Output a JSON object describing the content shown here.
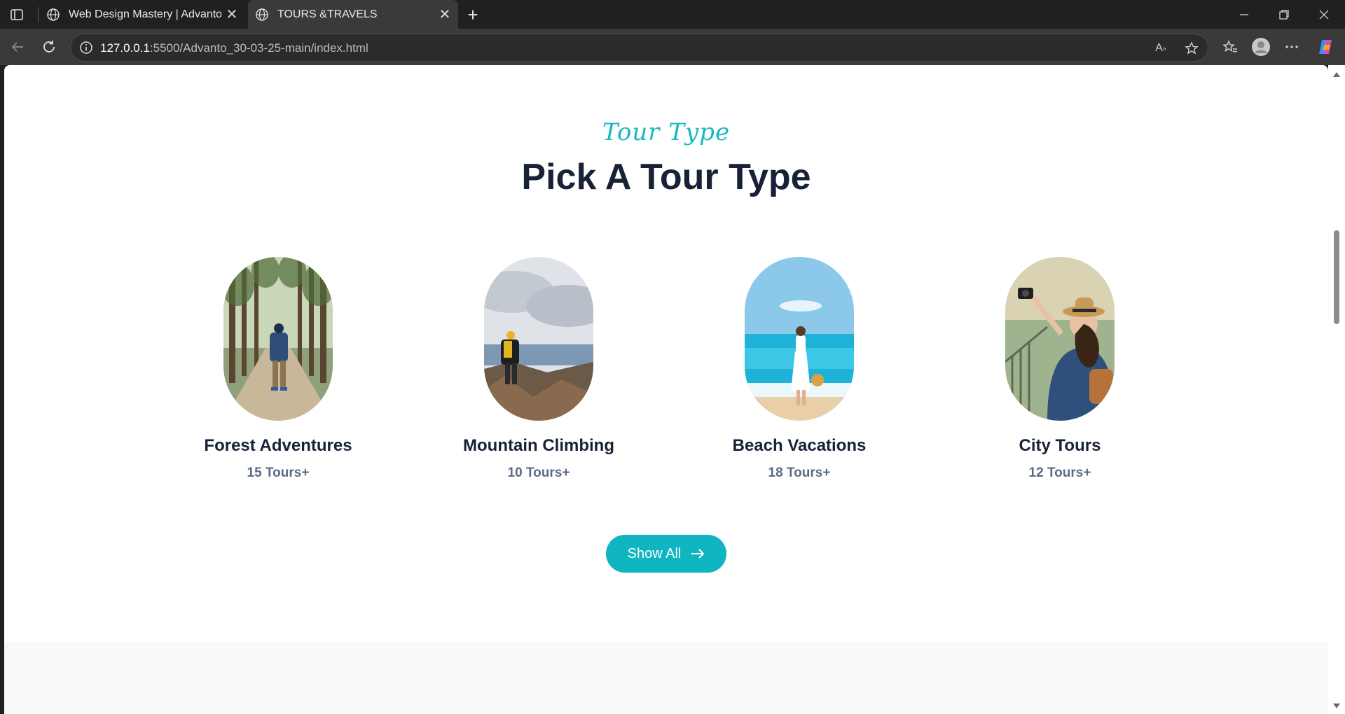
{
  "browser": {
    "tabs": [
      {
        "title": "Web Design Mastery | Advanto",
        "active": false
      },
      {
        "title": "TOURS &TRAVELS",
        "active": true
      }
    ],
    "url_host": "127.0.0.1",
    "url_rest": ":5500/Advanto_30-03-25-main/index.html"
  },
  "section": {
    "subheading": "Tour Type",
    "heading": "Pick A Tour Type",
    "accent_color": "#16b8c2",
    "heading_color": "#172238"
  },
  "tours": [
    {
      "title": "Forest Adventures",
      "count": "15 Tours+",
      "image": "hiker-in-forest"
    },
    {
      "title": "Mountain Climbing",
      "count": "10 Tours+",
      "image": "climber-on-peak"
    },
    {
      "title": "Beach Vacations",
      "count": "18 Tours+",
      "image": "woman-on-beach"
    },
    {
      "title": "City Tours",
      "count": "12 Tours+",
      "image": "tourist-with-camera"
    }
  ],
  "cta": {
    "label": "Show All",
    "icon": "arrow-right-icon",
    "color": "#0fb5c1"
  }
}
